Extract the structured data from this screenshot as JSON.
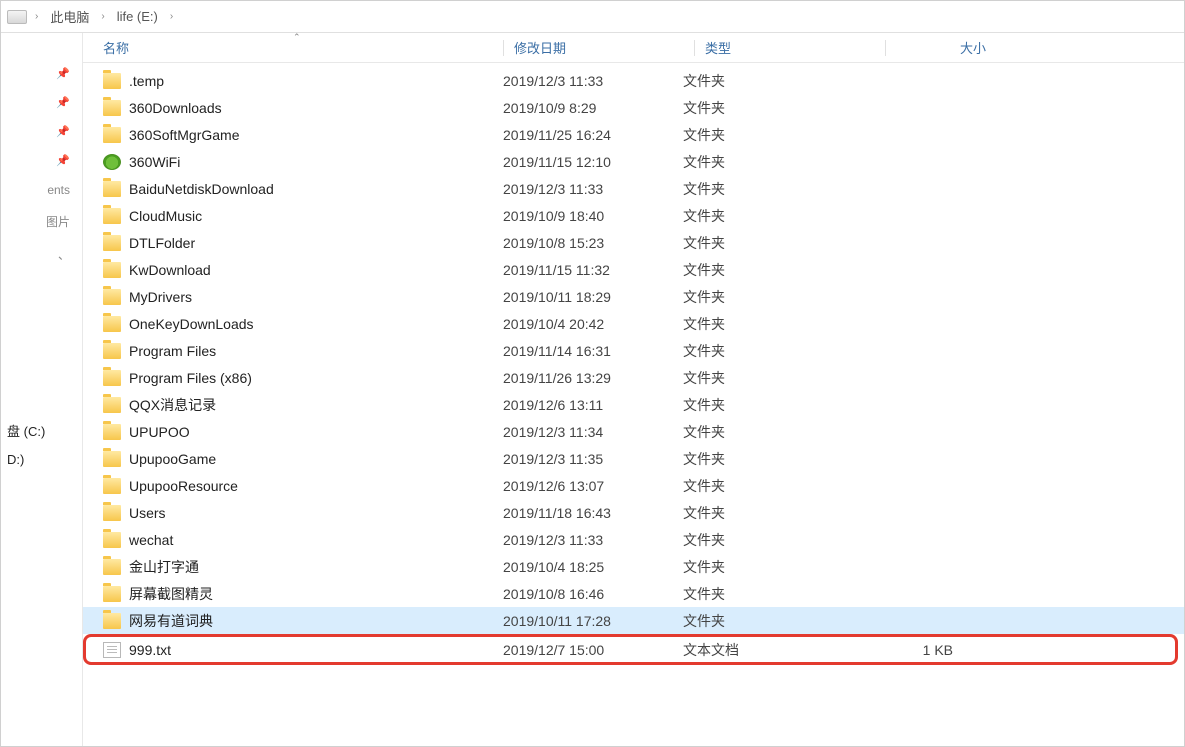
{
  "breadcrumb": {
    "root": "此电脑",
    "drive": "life (E:)"
  },
  "columns": {
    "name": "名称",
    "date": "修改日期",
    "type": "类型",
    "size": "大小"
  },
  "sidebar": {
    "truncated_items": [
      "ents",
      "图片"
    ],
    "drives": [
      "盘 (C:)",
      "D:)"
    ]
  },
  "items": [
    {
      "icon": "folder",
      "name": ".temp",
      "date": "2019/12/3 11:33",
      "type": "文件夹",
      "size": ""
    },
    {
      "icon": "folder",
      "name": "360Downloads",
      "date": "2019/10/9 8:29",
      "type": "文件夹",
      "size": ""
    },
    {
      "icon": "folder",
      "name": "360SoftMgrGame",
      "date": "2019/11/25 16:24",
      "type": "文件夹",
      "size": ""
    },
    {
      "icon": "wifi",
      "name": "360WiFi",
      "date": "2019/11/15 12:10",
      "type": "文件夹",
      "size": ""
    },
    {
      "icon": "folder",
      "name": "BaiduNetdiskDownload",
      "date": "2019/12/3 11:33",
      "type": "文件夹",
      "size": ""
    },
    {
      "icon": "folder",
      "name": "CloudMusic",
      "date": "2019/10/9 18:40",
      "type": "文件夹",
      "size": ""
    },
    {
      "icon": "folder",
      "name": "DTLFolder",
      "date": "2019/10/8 15:23",
      "type": "文件夹",
      "size": ""
    },
    {
      "icon": "folder",
      "name": "KwDownload",
      "date": "2019/11/15 11:32",
      "type": "文件夹",
      "size": ""
    },
    {
      "icon": "folder",
      "name": "MyDrivers",
      "date": "2019/10/11 18:29",
      "type": "文件夹",
      "size": ""
    },
    {
      "icon": "folder",
      "name": "OneKeyDownLoads",
      "date": "2019/10/4 20:42",
      "type": "文件夹",
      "size": ""
    },
    {
      "icon": "folder",
      "name": "Program Files",
      "date": "2019/11/14 16:31",
      "type": "文件夹",
      "size": ""
    },
    {
      "icon": "folder",
      "name": "Program Files (x86)",
      "date": "2019/11/26 13:29",
      "type": "文件夹",
      "size": ""
    },
    {
      "icon": "folder",
      "name": "QQX消息记录",
      "date": "2019/12/6 13:11",
      "type": "文件夹",
      "size": ""
    },
    {
      "icon": "folder",
      "name": "UPUPOO",
      "date": "2019/12/3 11:34",
      "type": "文件夹",
      "size": ""
    },
    {
      "icon": "folder",
      "name": "UpupooGame",
      "date": "2019/12/3 11:35",
      "type": "文件夹",
      "size": ""
    },
    {
      "icon": "folder",
      "name": "UpupooResource",
      "date": "2019/12/6 13:07",
      "type": "文件夹",
      "size": ""
    },
    {
      "icon": "folder",
      "name": "Users",
      "date": "2019/11/18 16:43",
      "type": "文件夹",
      "size": ""
    },
    {
      "icon": "folder",
      "name": "wechat",
      "date": "2019/12/3 11:33",
      "type": "文件夹",
      "size": ""
    },
    {
      "icon": "folder",
      "name": "金山打字通",
      "date": "2019/10/4 18:25",
      "type": "文件夹",
      "size": ""
    },
    {
      "icon": "folder",
      "name": "屏幕截图精灵",
      "date": "2019/10/8 16:46",
      "type": "文件夹",
      "size": ""
    },
    {
      "icon": "folder",
      "name": "网易有道词典",
      "date": "2019/10/11 17:28",
      "type": "文件夹",
      "size": "",
      "selected": true
    },
    {
      "icon": "txt",
      "name": "999.txt",
      "date": "2019/12/7 15:00",
      "type": "文本文档",
      "size": "1 KB",
      "highlight": true
    }
  ]
}
